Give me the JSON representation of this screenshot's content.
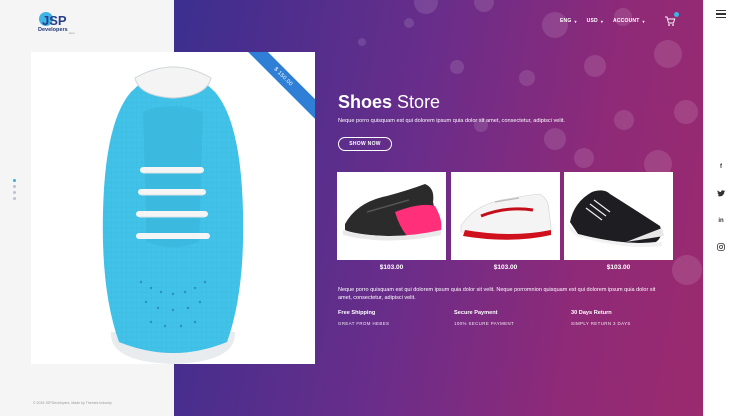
{
  "brand": {
    "logo_mark": "JSP",
    "name": "Developers",
    "suffix": ".com"
  },
  "nav": {
    "language": "ENG",
    "currency": "USD",
    "account": "ACCOUNT"
  },
  "icons": {
    "cart": "cart-icon",
    "menu": "hamburger-menu-icon",
    "caret": "caret-down-icon"
  },
  "colors": {
    "accent": "#3fb4e5",
    "ribbon": "#2f7fd6",
    "gradient_start": "#3b2f8f",
    "gradient_end": "#9b2a6e"
  },
  "product": {
    "price_ribbon": "$ 150.00"
  },
  "hero": {
    "title_bold": "Shoes",
    "title_light": "Store",
    "description": "Neque porro quisquam est qui dolorem ipsum quia dolor sit amet, consectetur, adipisci velit.",
    "button": "SHOW NOW",
    "long_description": "Neque porro quisquam est qui dolorem ipsum quia dolor sit velit. Neque porromnion quisquam est qui dolorem ipsum quia dolor sit amet, consectetur, adipisci velit."
  },
  "thumbnails": [
    {
      "price": "$103.00"
    },
    {
      "price": "$103.00"
    },
    {
      "price": "$103.00"
    }
  ],
  "features": [
    {
      "title": "Free Shipping",
      "subtitle": "GREAT FROM HEBES"
    },
    {
      "title": "Secure Payment",
      "subtitle": "100% SECURE PAYMENT"
    },
    {
      "title": "30 Days Return",
      "subtitle": "SIMPLY RETURN 3 DAYS"
    }
  ],
  "socials": [
    {
      "label": "f",
      "icon": "facebook-icon"
    },
    {
      "label": "t",
      "icon": "twitter-icon"
    },
    {
      "label": "in",
      "icon": "linkedin-icon"
    },
    {
      "label": "ig",
      "icon": "instagram-icon"
    }
  ],
  "footer": {
    "copyright": "© 2015 JSPDevelopers. Made by Themes Industry"
  }
}
